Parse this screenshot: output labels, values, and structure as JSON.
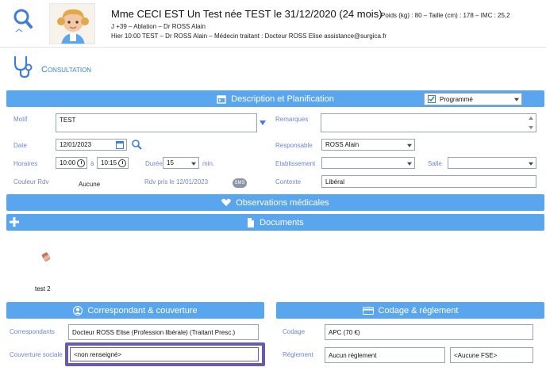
{
  "header": {
    "patient_title": "Mme CECI EST Un Test née TEST le 31/12/2020 (24 mois)",
    "line2": "J +39 – Ablation – Dr ROSS Alain",
    "line3": "Hier 10:00 TEST – Dr ROSS Alain – Médecin traitant : Docteur ROSS Elise assistance@surgica.fr",
    "vitals": "Poids (kg) : 80 – Taille (cm) : 178 – IMC : 25,2"
  },
  "consultation_label": "Consultation",
  "description_section": {
    "title": "Description  et Planification",
    "status_select": "Programmé"
  },
  "form": {
    "motif_label": "Motif",
    "motif_value": "TEST",
    "remarques_label": "Remarques",
    "remarques_value": "",
    "date_label": "Date",
    "date_value": "12/01/2023",
    "responsable_label": "Responsable",
    "responsable_value": "ROSS Alain",
    "horaires_label": "Horaires",
    "start_time": "10:00",
    "time_sep": "à",
    "end_time": "10:15",
    "duree_label": "Durée",
    "duree_value": "15",
    "duree_unit": "min.",
    "etablissement_label": "Etablissement",
    "etablissement_value": "",
    "salle_label": "Salle",
    "salle_value": "",
    "couleur_label": "Couleur Rdv",
    "couleur_value": "Aucune",
    "rdv_pris": "Rdv pris le 12/01/2023",
    "sms_badge": "SMS",
    "contexte_label": "Contexte",
    "contexte_value": "Libéral"
  },
  "observations_section": {
    "title": "Observations  médicales"
  },
  "documents_section": {
    "title": "Documents"
  },
  "test_item": "test 2",
  "correspondant_section": {
    "title": "Correspondant  & couverture",
    "correspondants_label": "Correspondants",
    "correspondants_value": "Docteur ROSS Elise (Profession libérale) (Traitant Presc.)",
    "couverture_label": "Couverture sociale",
    "couverture_value": "<non renseigné>"
  },
  "codage_section": {
    "title": "Codage & réglement",
    "codage_label": "Codage",
    "codage_value": "APC (70 €)",
    "reglement_label": "Réglement",
    "reglement_value": "Aucun réglement",
    "fse_value": "<Aucune FSE>"
  },
  "colors": {
    "section_bar": "#5aa6ee",
    "label_blue": "#6f86c9",
    "highlight_border": "#6a5aa8"
  },
  "icons": {
    "search": "magnifier",
    "stethoscope": "stethoscope",
    "calendar": "calendar",
    "plus": "plus",
    "document": "document",
    "person": "person",
    "card": "credit-card"
  }
}
